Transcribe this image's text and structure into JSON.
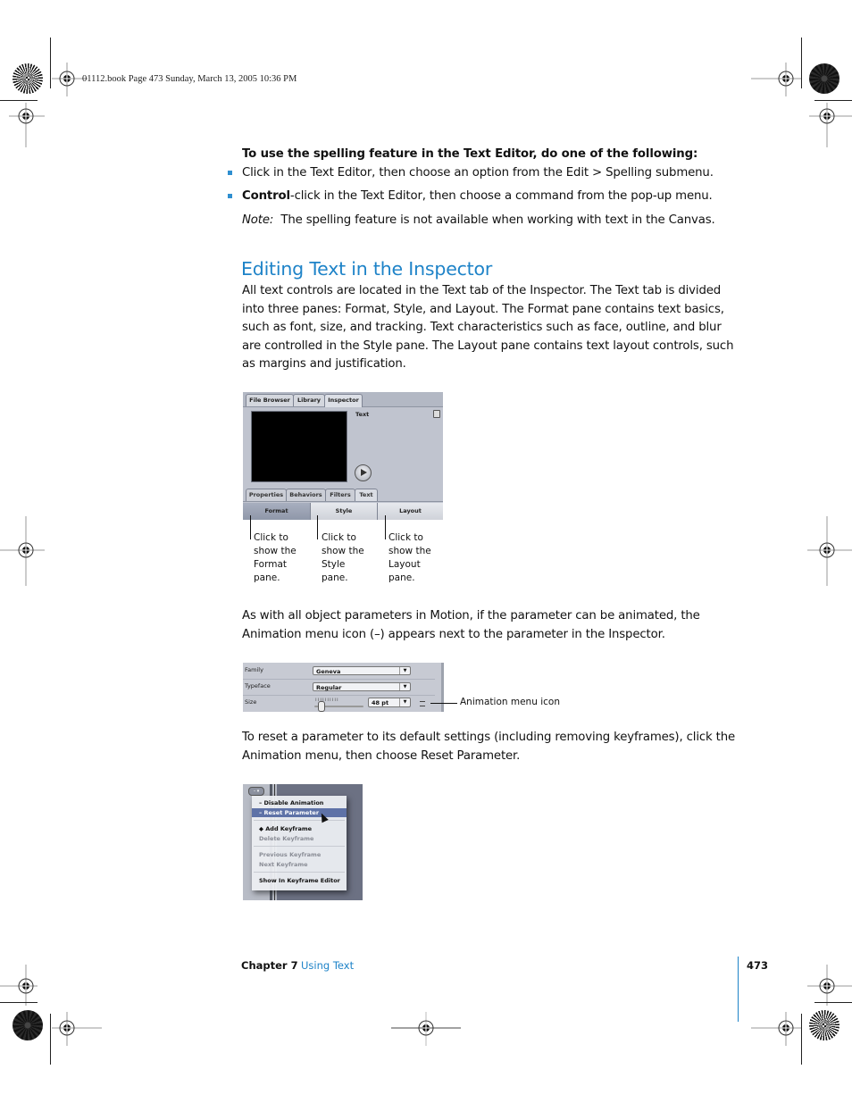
{
  "header": {
    "slug": "01112.book  Page 473  Sunday, March 13, 2005  10:36 PM"
  },
  "content": {
    "intro": "To use the spelling feature in the Text Editor, do one of the following:",
    "bullets": [
      {
        "bold": "",
        "text": "Click in the Text Editor, then choose an option from the Edit > Spelling submenu."
      },
      {
        "bold": "Control",
        "text": "-click in the Text Editor, then choose a command from the pop-up menu."
      }
    ],
    "note_label": "Note:",
    "note_text": "The spelling feature is not available when working with text in the Canvas.",
    "heading": "Editing Text in the Inspector",
    "para1": "All text controls are located in the Text tab of the Inspector. The Text tab is divided into three panes:  Format, Style, and Layout. The Format pane contains text basics, such as font, size, and tracking. Text characteristics such as face, outline, and blur are controlled in the Style pane. The Layout pane contains text layout controls, such as margins and justification.",
    "para2": "As with all object parameters in Motion, if the parameter can be animated, the Animation menu icon (–) appears next to the parameter in the Inspector.",
    "para3": "To reset a parameter to its default settings (including removing keyframes), click the Animation menu, then choose Reset Parameter."
  },
  "inspector_shot": {
    "top_tabs": [
      "File Browser",
      "Library",
      "Inspector"
    ],
    "active_top_tab": "Inspector",
    "object_label": "Text",
    "sub_tabs": [
      "Properties",
      "Behaviors",
      "Filters",
      "Text"
    ],
    "active_sub_tab": "Text",
    "panes": [
      "Format",
      "Style",
      "Layout"
    ],
    "active_pane": "Format",
    "callouts": [
      "Click to show the Format pane.",
      "Click to show the Style pane.",
      "Click to show the Layout pane."
    ]
  },
  "params_shot": {
    "rows": [
      {
        "label": "Family",
        "value": "Geneva"
      },
      {
        "label": "Typeface",
        "value": "Regular"
      },
      {
        "label": "Size",
        "value": "48 pt"
      }
    ],
    "callout": "Animation menu icon"
  },
  "menu_shot": {
    "items": [
      {
        "label": "Disable Animation",
        "prefix": "–",
        "state": "enabled"
      },
      {
        "label": "Reset Parameter",
        "prefix": "–",
        "state": "selected"
      },
      {
        "label": "Add Keyframe",
        "prefix": "◆",
        "state": "enabled"
      },
      {
        "label": "Delete Keyframe",
        "prefix": "",
        "state": "disabled"
      },
      {
        "label": "Previous Keyframe",
        "prefix": "",
        "state": "disabled"
      },
      {
        "label": "Next Keyframe",
        "prefix": "",
        "state": "disabled"
      },
      {
        "label": "Show In Keyframe Editor",
        "prefix": "",
        "state": "enabled"
      }
    ]
  },
  "footer": {
    "chapter": "Chapter 7",
    "chapter_title": "Using Text",
    "page_number": "473"
  },
  "colors": {
    "accent": "#1e83c8",
    "bullet": "#2f8fd0"
  }
}
